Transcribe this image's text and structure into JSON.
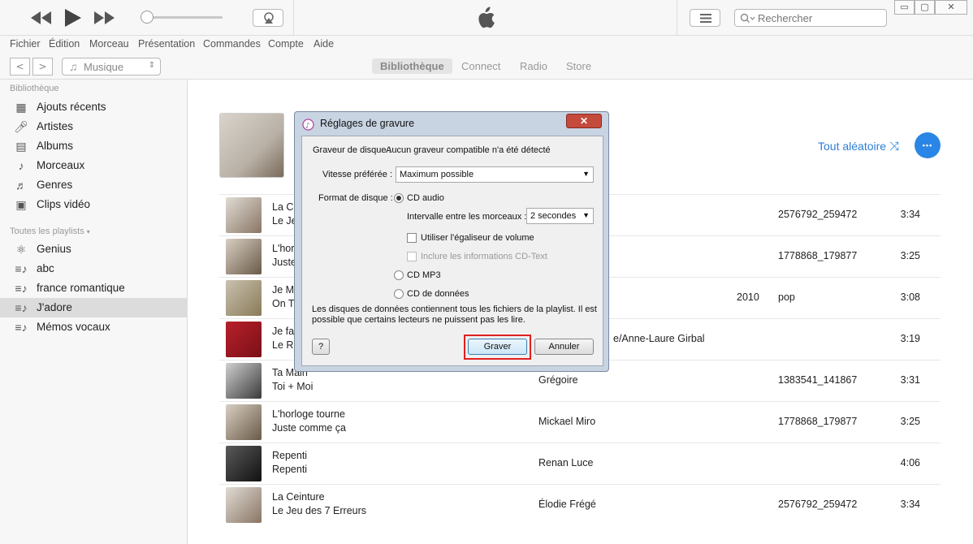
{
  "window": {
    "minimize": "▭",
    "restore": "▢",
    "close": "✕"
  },
  "search": {
    "placeholder": "Rechercher"
  },
  "menu": [
    "Fichier",
    "Édition",
    "Morceau",
    "Présentation",
    "Commandes",
    "Compte",
    "Aide"
  ],
  "nav": {
    "media": "Musique",
    "tabs": [
      "Bibliothèque",
      "Connect",
      "Radio",
      "Store"
    ]
  },
  "sidebar": {
    "library_header": "Bibliothèque",
    "library": [
      {
        "label": "Ajouts récents",
        "icon": "grid-icon"
      },
      {
        "label": "Artistes",
        "icon": "microphone-icon"
      },
      {
        "label": "Albums",
        "icon": "album-icon"
      },
      {
        "label": "Morceaux",
        "icon": "note-icon"
      },
      {
        "label": "Genres",
        "icon": "genres-icon"
      },
      {
        "label": "Clips vidéo",
        "icon": "video-icon"
      }
    ],
    "playlists_header": "Toutes les playlists",
    "playlists": [
      {
        "label": "Genius",
        "icon": "genius-icon"
      },
      {
        "label": "abc",
        "icon": "playlist-icon"
      },
      {
        "label": "france romantique",
        "icon": "playlist-icon"
      },
      {
        "label": "J'adore",
        "icon": "playlist-icon"
      },
      {
        "label": "Mémos vocaux",
        "icon": "playlist-icon"
      }
    ]
  },
  "main": {
    "shuffle": "Tout aléatoire",
    "more": "•••",
    "tracks": [
      {
        "t1": "La Ce",
        "t2": "Le Je",
        "artist": "",
        "year": "",
        "genre": "",
        "comp": "2576792_259472",
        "dur": "3:34"
      },
      {
        "t1": "L'hor",
        "t2": "Juste",
        "artist": "",
        "year": "",
        "genre": "",
        "comp": "1778868_179877",
        "dur": "3:25"
      },
      {
        "t1": "Je Me",
        "t2": "On Tr",
        "artist": "",
        "year": "2010",
        "genre": "pop",
        "comp": "",
        "dur": "3:08"
      },
      {
        "t1": "Je fai",
        "t2": "Le Ro",
        "artist": "e/Anne-Laure Girbal",
        "year": "",
        "genre": "",
        "comp": "",
        "dur": "3:19"
      },
      {
        "t1": "Ta Main",
        "t2": "Toi + Moi",
        "artist": "Grégoire",
        "year": "",
        "genre": "",
        "comp": "1383541_141867",
        "dur": "3:31"
      },
      {
        "t1": "L'horloge tourne",
        "t2": "Juste comme ça",
        "artist": "Mickael Miro",
        "year": "",
        "genre": "",
        "comp": "1778868_179877",
        "dur": "3:25"
      },
      {
        "t1": "Repenti",
        "t2": "Repenti",
        "artist": "Renan Luce",
        "year": "",
        "genre": "",
        "comp": "",
        "dur": "4:06"
      },
      {
        "t1": "La Ceinture",
        "t2": "Le Jeu des 7 Erreurs",
        "artist": "Élodie Frégé",
        "year": "",
        "genre": "",
        "comp": "2576792_259472",
        "dur": "3:34"
      }
    ]
  },
  "dialog": {
    "title": "Réglages de gravure",
    "close": "✕",
    "burner_label": "Graveur de disque :",
    "burner_value": "Aucun graveur compatible n'a été détecté",
    "speed_label": "Vitesse préférée :",
    "speed_value": "Maximum possible",
    "format_label": "Format de disque :",
    "cd_audio": "CD audio",
    "gap_label": "Intervalle entre les morceaux :",
    "gap_value": "2 secondes",
    "volume_eq": "Utiliser l'égaliseur de volume",
    "cd_text": "Inclure les informations CD-Text",
    "cd_mp3": "CD MP3",
    "data_cd": "CD de données",
    "note": "Les disques de données contiennent tous les fichiers de la playlist. Il est possible que certains lecteurs ne puissent pas les lire.",
    "help": "?",
    "burn": "Graver",
    "cancel": "Annuler"
  }
}
